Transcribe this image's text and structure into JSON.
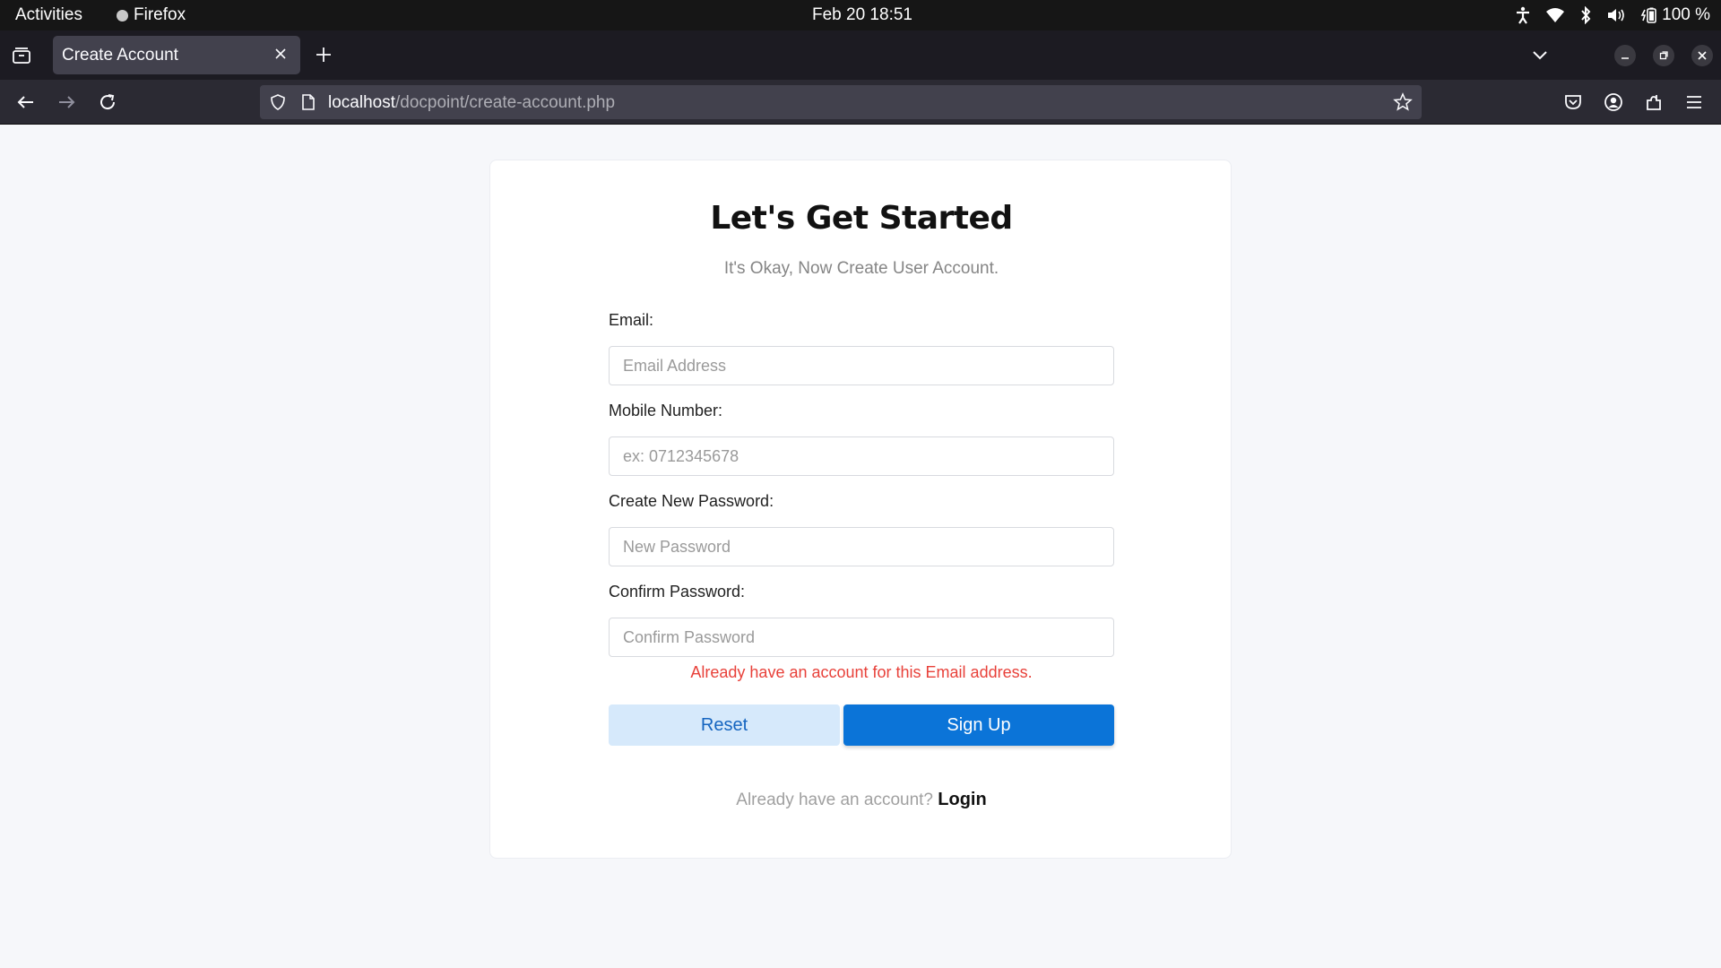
{
  "system_bar": {
    "activities": "Activities",
    "app_name": "Firefox",
    "clock": "Feb 20  18:51",
    "battery": "100 %"
  },
  "browser": {
    "tab_title": "Create Account",
    "url_host": "localhost",
    "url_path": "/docpoint/create-account.php"
  },
  "form": {
    "title": "Let's Get Started",
    "subtitle": "It's Okay, Now Create User Account.",
    "email_label": "Email:",
    "email_placeholder": "Email Address",
    "email_value": "",
    "mobile_label": "Mobile Number:",
    "mobile_placeholder": "ex: 0712345678",
    "mobile_value": "",
    "password_label": "Create New Password:",
    "password_placeholder": "New Password",
    "password_value": "",
    "confirm_label": "Confirm Password:",
    "confirm_placeholder": "Confirm Password",
    "confirm_value": "",
    "error_message": "Already have an account for this Email address.",
    "reset_label": "Reset",
    "signup_label": "Sign Up",
    "footer_prompt": "Already have an account? ",
    "login_link": "Login"
  },
  "colors": {
    "primary": "#0b74d8",
    "reset_bg": "#d6e9fb",
    "error": "#e8413a"
  },
  "icons": [
    "tab-list-icon",
    "close-icon",
    "plus-icon",
    "chevron-down-icon",
    "minimize-icon",
    "restore-icon",
    "back-arrow-icon",
    "forward-arrow-icon",
    "reload-icon",
    "shield-icon",
    "page-icon",
    "star-icon",
    "pocket-icon",
    "account-icon",
    "extensions-icon",
    "menu-icon",
    "accessibility-icon",
    "wifi-icon",
    "bluetooth-icon",
    "volume-icon",
    "battery-icon"
  ]
}
